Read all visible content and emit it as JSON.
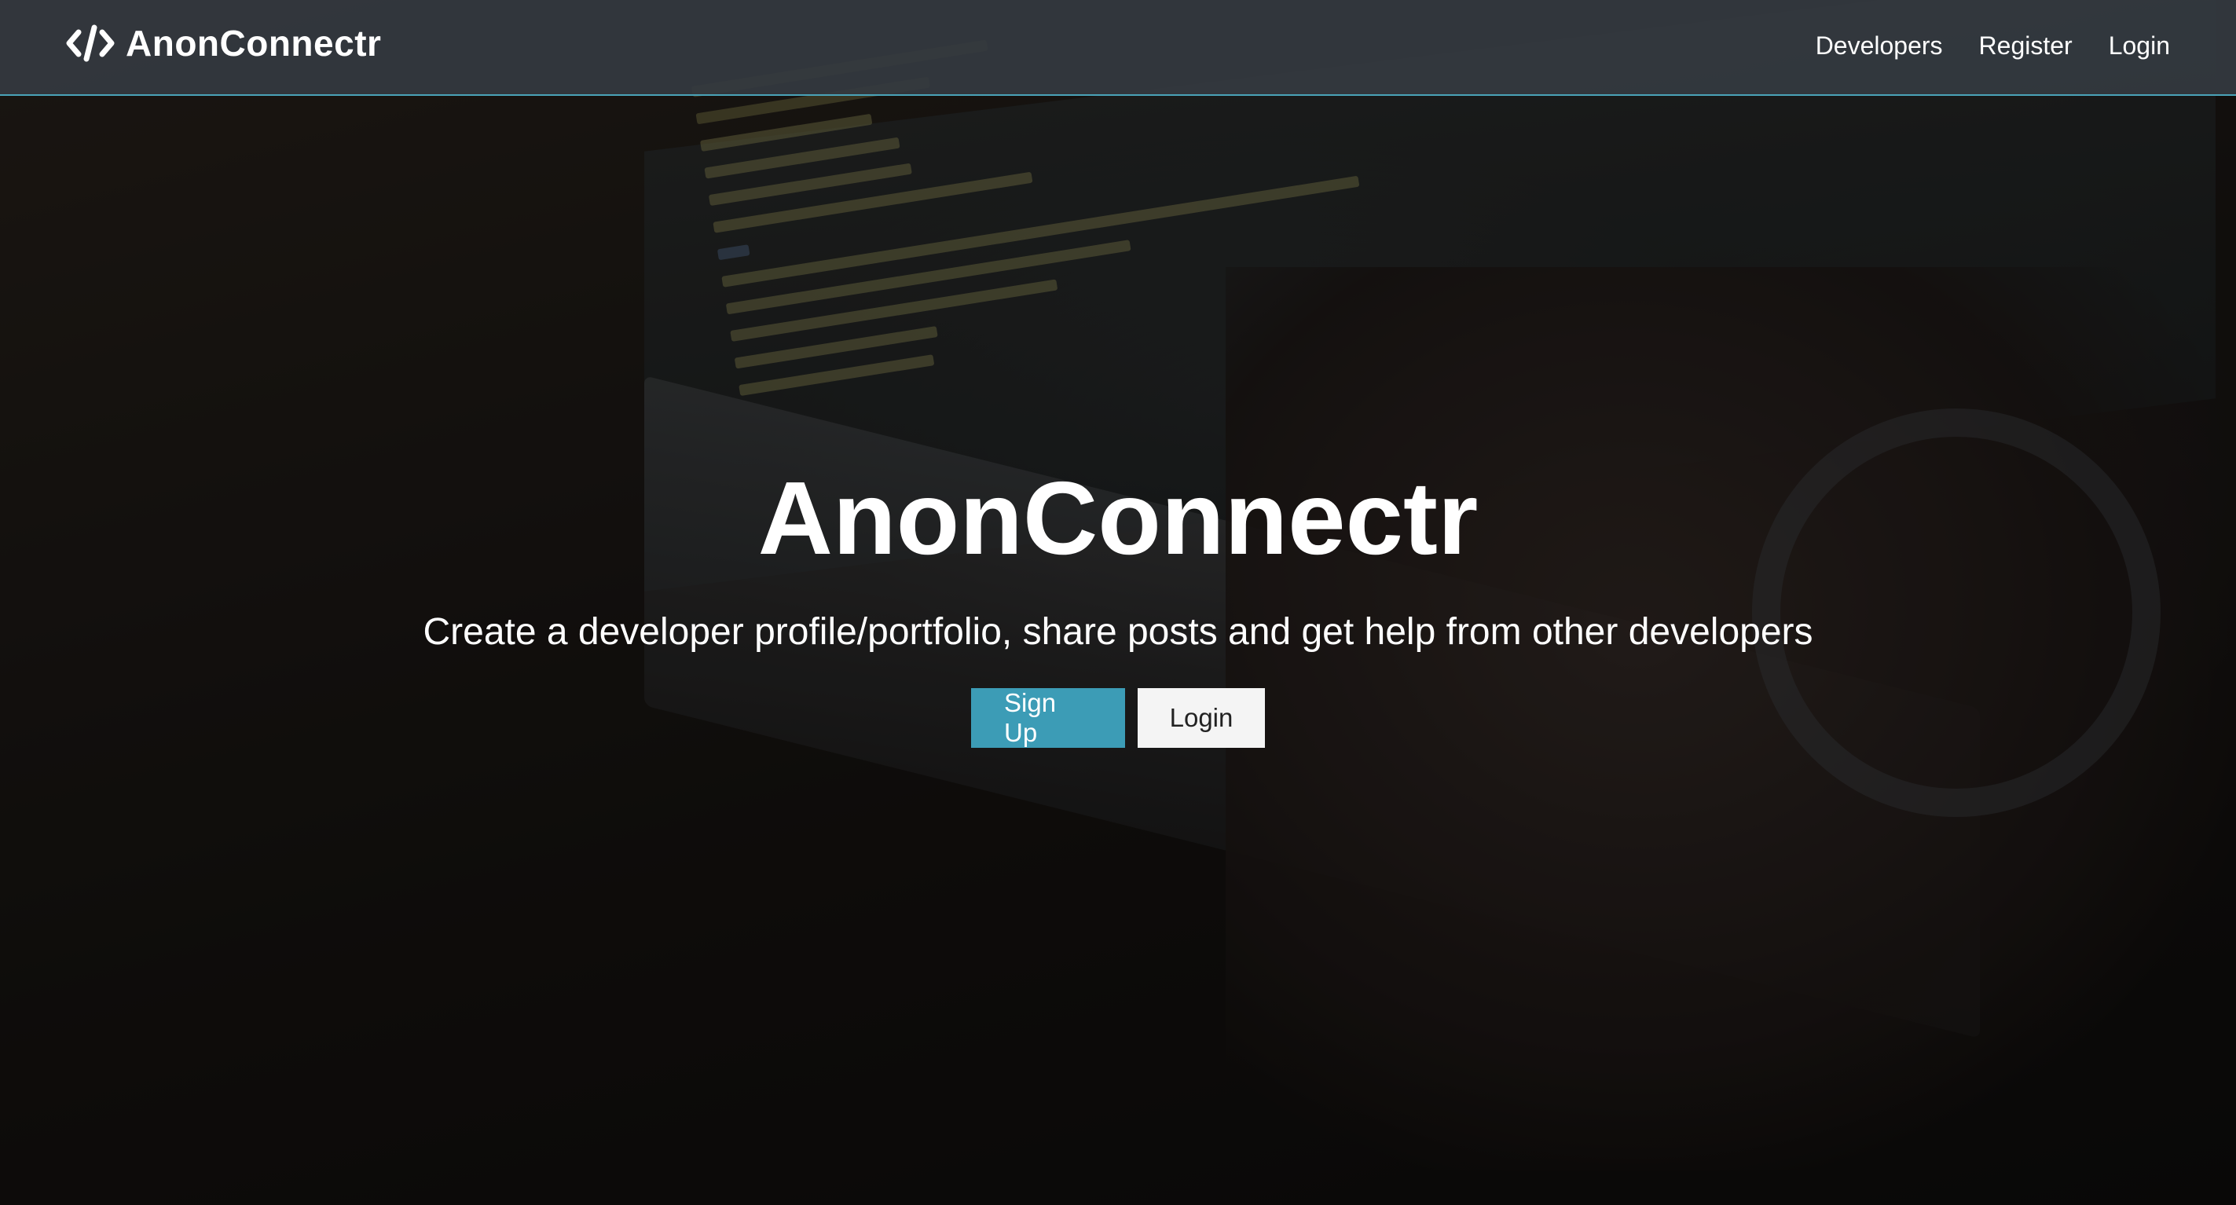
{
  "navbar": {
    "brand": "AnonConnectr",
    "brand_icon": "code-icon",
    "links": [
      "Developers",
      "Register",
      "Login"
    ]
  },
  "hero": {
    "title": "AnonConnectr",
    "lead": "Create a developer profile/portfolio, share posts and get help from other developers",
    "signup_label": "Sign Up",
    "login_label": "Login"
  },
  "colors": {
    "accent": "#3c9cb6",
    "navbar_bg": "#343a40",
    "navbar_border": "#4aa3b8"
  }
}
